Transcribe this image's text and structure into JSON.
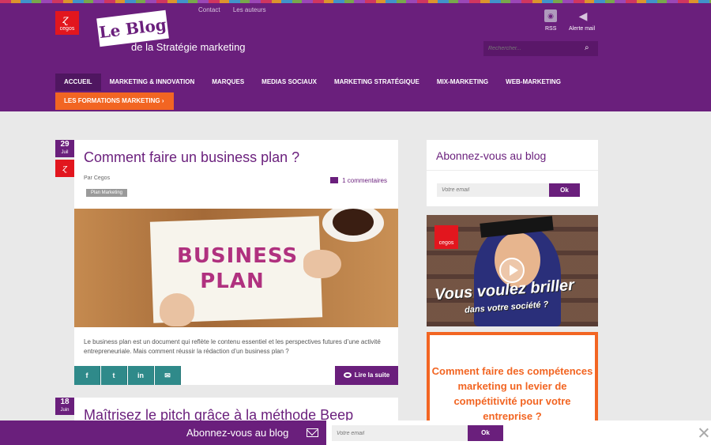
{
  "header": {
    "logo_text": "cegos",
    "blog_badge": "Le Blog",
    "blog_subtitle": "de la Stratégie marketing",
    "top_links": [
      "Contact",
      "Les auteurs"
    ],
    "rss_label": "RSS",
    "alert_label": "Alerte mail",
    "search_placeholder": "Rechercher..."
  },
  "nav": {
    "items": [
      "ACCUEIL",
      "MARKETING & INNOVATION",
      "MARQUES",
      "MEDIAS SOCIAUX",
      "MARKETING STRATÉGIQUE",
      "MIX-MARKETING",
      "WEB-MARKETING"
    ],
    "formations_label": "LES FORMATIONS MARKETING  ›"
  },
  "posts": [
    {
      "day": "29",
      "month": "Juil",
      "title": "Comment faire un business plan ?",
      "author": "Par Cegos",
      "comments": "1 commentaires",
      "tag": "Plan Marketing",
      "hero_text": "BUSINESS PLAN",
      "excerpt": "Le business plan est un document qui reflète le contenu essentiel et les perspectives futures d’une activité entrepreneuriale. Mais comment réussir la rédaction d’un business plan ?",
      "share": [
        "f",
        "t",
        "in",
        "✉"
      ],
      "read_more": "Lire la suite"
    },
    {
      "day": "18",
      "month": "Juin",
      "title": "Maîtrisez le pitch grâce à la méthode Beep"
    }
  ],
  "sidebar": {
    "subscribe_title": "Abonnez-vous au blog",
    "email_placeholder": "Votre email",
    "ok_label": "Ok",
    "promo_logo": "cegos",
    "promo_line1": "Vous voulez briller",
    "promo_line2": "dans votre société ?",
    "cta_text": "Comment faire des compétences marketing un levier de compétitivité pour votre entreprise ?"
  },
  "bottom_bar": {
    "title": "Abonnez-vous au blog",
    "email_placeholder": "Votre email",
    "ok_label": "Ok"
  }
}
